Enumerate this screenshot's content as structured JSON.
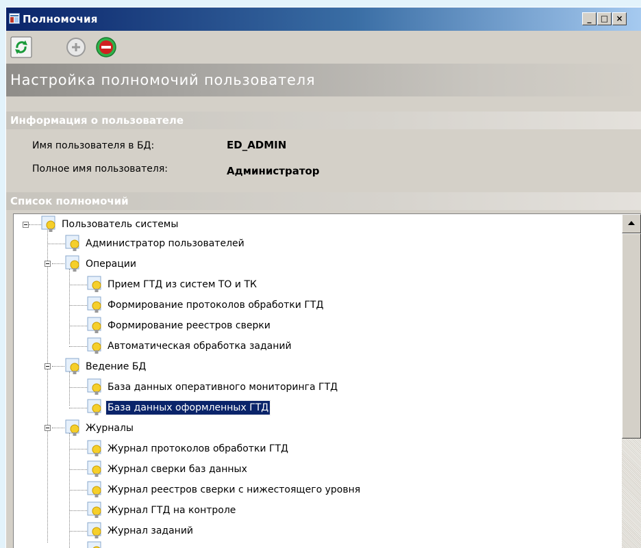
{
  "window": {
    "title": "Полномочия",
    "controls": {
      "minimize": "_",
      "maximize": "□",
      "close": "×"
    }
  },
  "toolbar": {
    "buttons": [
      {
        "name": "refresh",
        "icon": "refresh-icon",
        "enabled": true
      },
      {
        "name": "add",
        "icon": "plus-icon",
        "enabled": false
      },
      {
        "name": "remove",
        "icon": "minus-icon",
        "enabled": true
      }
    ]
  },
  "header": {
    "title": "Настройка полномочий пользователя"
  },
  "user_info": {
    "section_title": "Информация о пользователе",
    "db_user_label": "Имя пользователя в БД:",
    "db_user_value": "ED_ADMIN",
    "full_name_label": "Полное имя пользователя:",
    "full_name_value": "Администратор"
  },
  "permissions": {
    "section_title": "Список полномочий",
    "selected": "База данных оформленных ГТД",
    "tree": {
      "root": "Пользователь системы",
      "admin": "Администратор пользователей",
      "ops": {
        "label": "Операции",
        "items": [
          "Прием ГТД из систем ТО и ТК",
          "Формирование протоколов обработки ГТД",
          "Формирование реестров сверки",
          "Автоматическая обработка заданий"
        ]
      },
      "db": {
        "label": "Ведение БД",
        "items": [
          "База данных оперативного мониторинга ГТД",
          "База данных оформленных ГТД"
        ]
      },
      "journals": {
        "label": "Журналы",
        "items": [
          "Журнал протоколов обработки ГТД",
          "Журнал сверки баз данных",
          "Журнал реестров сверки с нижестоящего уровня",
          "Журнал ГТД на контроле",
          "Журнал заданий"
        ]
      }
    }
  },
  "colors": {
    "titlebar_start": "#0a246a",
    "titlebar_end": "#a6caf0",
    "selection": "#0a246a",
    "window_bg": "#d4d0c8",
    "bulb": "#f5cf2b",
    "refresh_green": "#1a9a3a",
    "remove_green": "#2fb24a",
    "remove_red": "#d02020"
  }
}
